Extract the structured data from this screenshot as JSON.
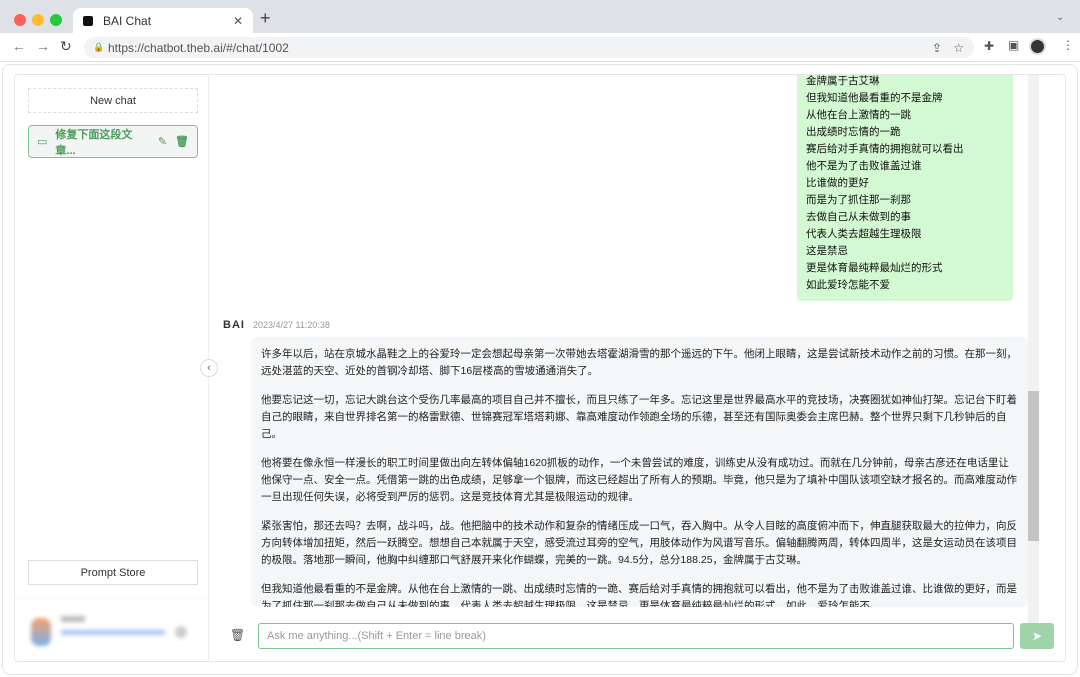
{
  "browser": {
    "tab_title": "BAI Chat",
    "url": "https://chatbot.theb.ai/#/chat/1002"
  },
  "sidebar": {
    "new_chat": "New chat",
    "chats": [
      {
        "label": "修复下面这段文章..."
      }
    ],
    "prompt_store": "Prompt Store"
  },
  "user_message": {
    "lines": [
      "金牌属于古艾琳",
      "但我知道他最看重的不是金牌",
      "从他在台上激情的一跳",
      "出成绩时忘情的一跪",
      "赛后给对手真情的拥抱就可以看出",
      "他不是为了击败谁盖过谁",
      "比谁做的更好",
      "而是为了抓住那一刹那",
      "去做自己从未做到的事",
      "代表人类去超越生理极限",
      "这是禁忌",
      "更是体育最纯粹最灿烂的形式",
      "如此爱玲怎能不爱"
    ]
  },
  "assistant": {
    "name": "BAI",
    "timestamp": "2023/4/27 11:20:38",
    "paragraphs": [
      "许多年以后，站在京城水晶鞋之上的谷爱玲一定会想起母亲第一次带她去塔霍湖滑雪的那个遥远的下午。他闭上眼睛，这是尝试新技术动作之前的习惯。在那一刻，远处湛蓝的天空、近处的首钢冷却塔、脚下16层楼高的雪坡通通消失了。",
      "他要忘记这一切，忘记大跳台这个受伤几率最高的项目自己并不擅长，而且只练了一年多。忘记这里是世界最高水平的竞技场，决赛圈犹如神仙打架。忘记台下盯着自己的眼睛，来自世界排名第一的格雷默德、世锦赛冠军塔塔莉娜、靠高难度动作领跑全场的乐德，甚至还有国际奥委会主席巴赫。整个世界只剩下几秒钟后的自己。",
      "他将要在像永恒一样漫长的职工时间里做出向左转体偏轴1620抓板的动作，一个未曾尝试的难度，训练史从没有成功过。而就在几分钟前，母亲古彦还在电话里让他保守一点、安全一点。凭借第一跳的出色成绩，足够拿一个银牌，而这已经超出了所有人的预期。毕竟，他只是为了填补中国队该项空缺才报名的。而高难度动作一旦出现任何失误，必将受到严厉的惩罚。这是竞技体育尤其是极限运动的规律。",
      "紧张害怕，那还去吗？去啊，战斗吗，战。他把脑中的技术动作和复杂的情绪压成一口气，吞入胸中。从令人目眩的高度俯冲而下，伸直腿获取最大的拉伸力，向反方向转体增加扭矩，然后一跃腾空。想想自己本就属于天空，感受流过耳旁的空气，用肢体动作为风谱写音乐。偏轴翻腾两周，转体四周半，这是女运动员在该项目的极限。落地那一瞬间，他胸中纠缠那口气舒展开来化作蝴蝶，完美的一跳。94.5分，总分188.25，金牌属于古艾琳。",
      "但我知道他最看重的不是金牌。从他在台上激情的一跳、出成绩时忘情的一跪、赛后给对手真情的拥抱就可以看出，他不是为了击败谁盖过谁、比谁做的更好，而是为了抓住那一刹那去做自己从未做到的事，代表人类去超越生理极限。这是禁忌，更是体育最纯粹最灿烂的形式。如此，爱玲怎能不"
    ]
  },
  "composer": {
    "placeholder": "Ask me anything...(Shift + Enter = line break)"
  },
  "colors": {
    "accent": "#4a9d5a",
    "user_bubble": "#d2f9d1",
    "send": "#9fd4a8"
  }
}
